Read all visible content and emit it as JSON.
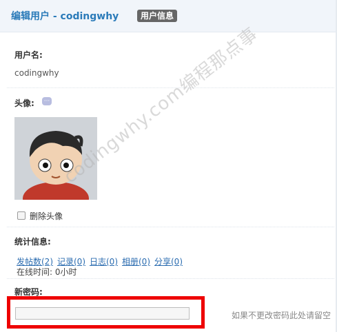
{
  "header": {
    "title": "编辑用户 - codingwhy",
    "tag": "用户信息"
  },
  "username": {
    "label": "用户名:",
    "value": "codingwhy"
  },
  "avatar": {
    "label": "头像:",
    "help_icon": "speech-bubble-icon",
    "delete_label": "删除头像"
  },
  "stats": {
    "label": "统计信息:",
    "links": [
      "发帖数(2)",
      "记录(0)",
      "日志(0)",
      "相册(0)",
      "分享(0)"
    ],
    "online_time": "在线时间: 0小时"
  },
  "password": {
    "label": "新密码:",
    "value": "",
    "hint": "如果不更改密码此处请留空"
  },
  "watermark": "codingwhy.com编程那点事",
  "colors": {
    "title": "#2b7bb9",
    "highlight": "#ee0000",
    "link": "#2b6cb0"
  }
}
